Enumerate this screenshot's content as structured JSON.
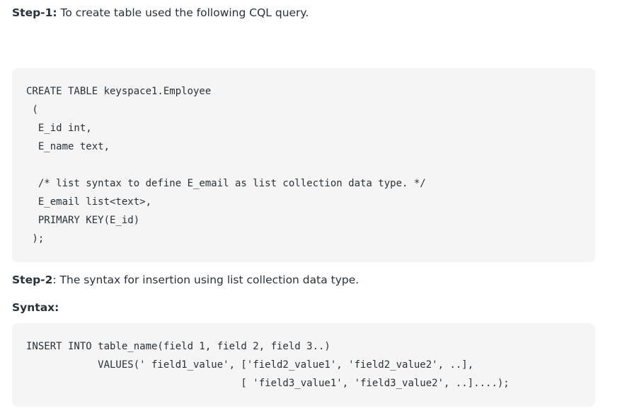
{
  "step1": {
    "label": "Step-1:",
    "text": " To create table used the following CQL query."
  },
  "code1": {
    "lines": [
      "CREATE TABLE keyspace1.Employee",
      " (",
      "  E_id int,",
      "  E_name text,",
      "",
      "  /* list syntax to define E_email as list collection data type. */",
      "  E_email list<text>,",
      "  PRIMARY KEY(E_id)",
      " );"
    ]
  },
  "step2": {
    "label": "Step-2",
    "text": ": The syntax for insertion using list collection data type."
  },
  "syntax": {
    "label": "Syntax:"
  },
  "code2": {
    "lines": [
      "INSERT INTO table_name(field 1, field 2, field 3..)",
      "            VALUES(' field1_value', ['field2_value1', 'field2_value2', ..],",
      "                                    [ 'field3_value1', 'field3_value2', ..]....);"
    ]
  }
}
